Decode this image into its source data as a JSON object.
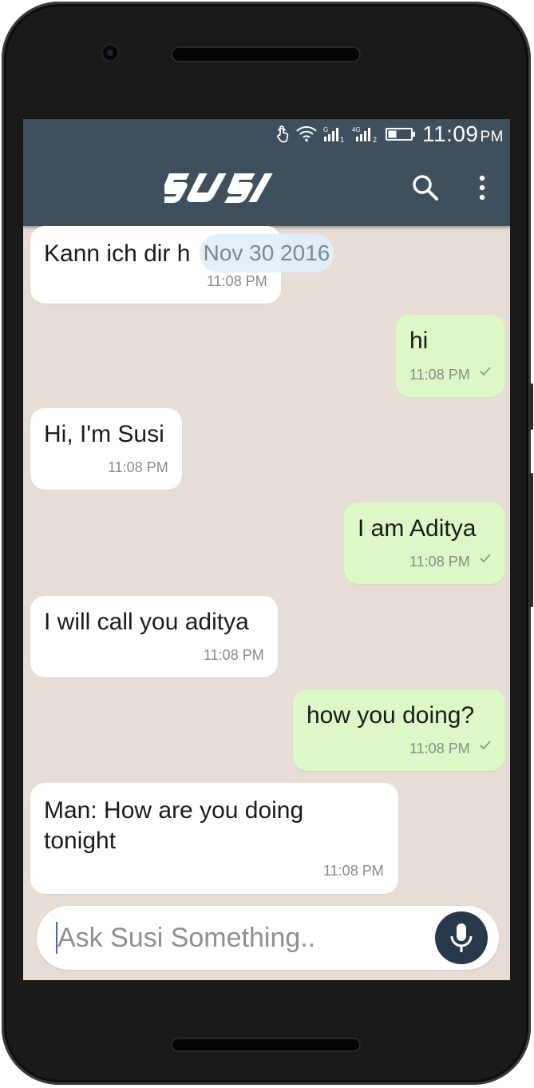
{
  "status_bar": {
    "time": "11:09",
    "ampm": "PM"
  },
  "app_bar": {
    "logo_text": "SUSI",
    "colors": {
      "bar": "#3e4f5e"
    }
  },
  "date_chip": "Nov 30 2016",
  "messages": [
    {
      "side": "in",
      "text": "Kann ich dir h",
      "time": "11:08 PM"
    },
    {
      "side": "out",
      "text": "hi",
      "time": "11:08 PM"
    },
    {
      "side": "in",
      "text": "Hi, I'm Susi",
      "time": "11:08 PM"
    },
    {
      "side": "out",
      "text": "I am Aditya",
      "time": "11:08 PM"
    },
    {
      "side": "in",
      "text": "I will call you aditya",
      "time": "11:08 PM"
    },
    {
      "side": "out",
      "text": "how you doing?",
      "time": "11:08 PM"
    },
    {
      "side": "in",
      "text_line1": "Man: How are you doing",
      "text_line2": "tonight",
      "time": "11:08 PM"
    }
  ],
  "composer": {
    "placeholder": "Ask Susi Something..",
    "value": ""
  },
  "icons": {
    "status": [
      "touch-icon",
      "wifi-icon",
      "signal-sim1-icon",
      "signal-4g-sim2-icon",
      "battery-icon"
    ],
    "app_bar": [
      "search-icon",
      "more-vert-icon"
    ],
    "composer": [
      "mic-icon"
    ],
    "message": [
      "check-icon"
    ]
  },
  "colors": {
    "incoming": "#ffffff",
    "outgoing": "#dcf8c6",
    "background": "#e6ddd6",
    "mic_button": "#27394a"
  }
}
